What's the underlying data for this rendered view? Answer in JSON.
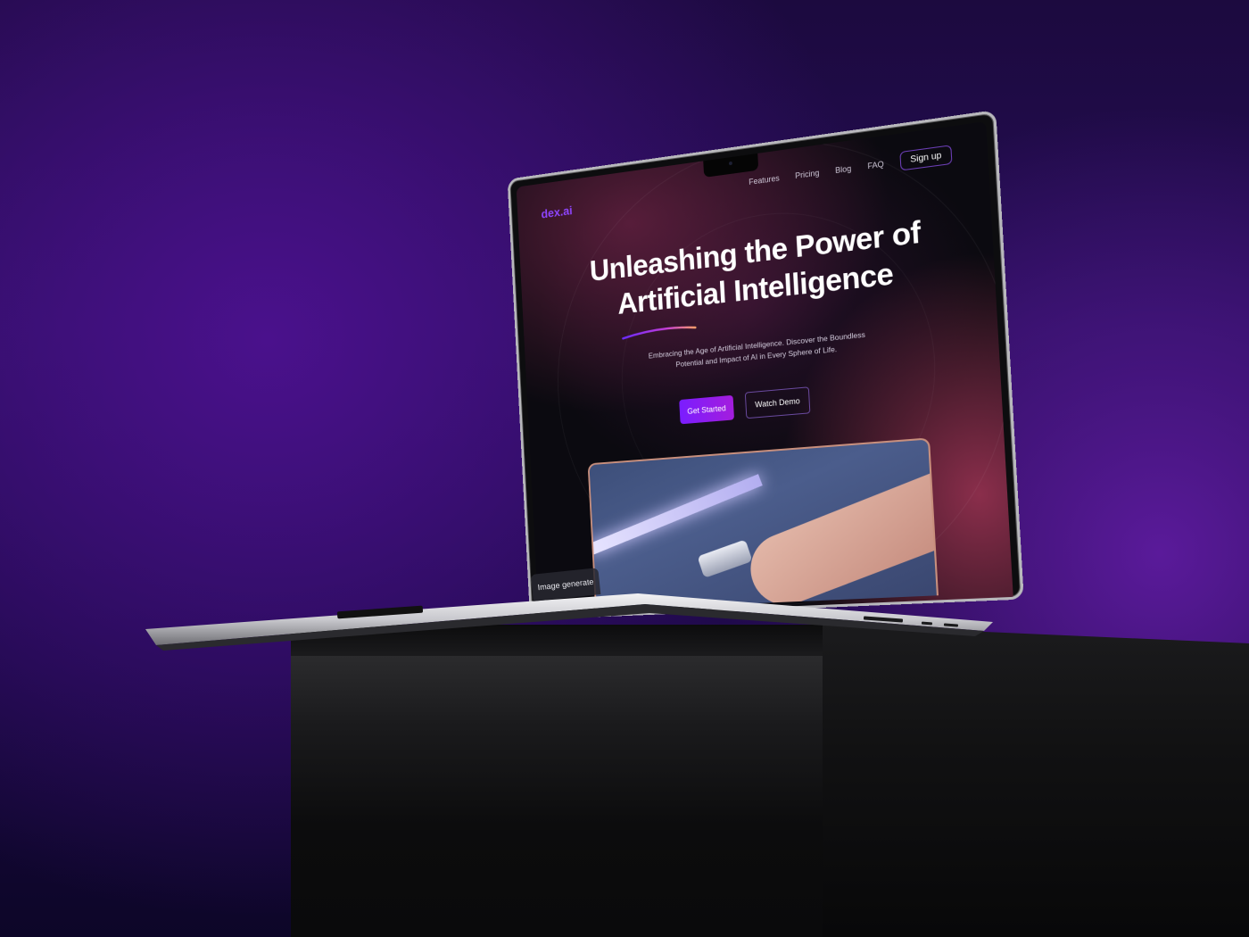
{
  "website": {
    "logo": "dex.ai",
    "nav": {
      "items": [
        "Features",
        "Pricing",
        "Blog",
        "FAQ"
      ],
      "signup_label": "Sign up"
    },
    "hero": {
      "title_line1": "Unleashing the Power of",
      "title_line2": "Artificial Intelligence",
      "subtitle_line1": "Embracing the Age of Artificial Intelligence. Discover the Boundless",
      "subtitle_line2": "Potential and Impact of AI in Every Sphere of Life.",
      "primary_button": "Get Started",
      "secondary_button": "Watch Demo"
    },
    "preview_card": {
      "label": "Image generate"
    }
  },
  "colors": {
    "accent": "#8f45ff",
    "primary_button_start": "#7a1dff",
    "primary_button_end": "#a41ddd",
    "background_purple": "#3b1076"
  }
}
